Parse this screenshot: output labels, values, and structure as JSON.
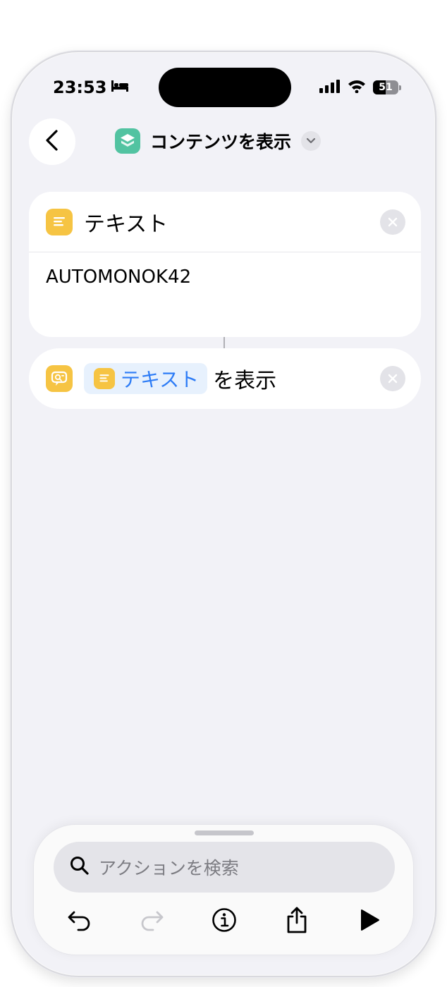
{
  "status_bar": {
    "time": "23:53",
    "battery_level": "51"
  },
  "header": {
    "title": "コンテンツを表示"
  },
  "text_action": {
    "title": "テキスト",
    "content": "AUTOMONOK42"
  },
  "show_action": {
    "token_label": "テキスト",
    "suffix": "を表示"
  },
  "bottom_panel": {
    "search_placeholder": "アクションを検索"
  },
  "colors": {
    "accent": "#2d7cf6",
    "text_action": "#f6c443",
    "app_icon": "#52c3a1",
    "background": "#f2f2f7"
  }
}
